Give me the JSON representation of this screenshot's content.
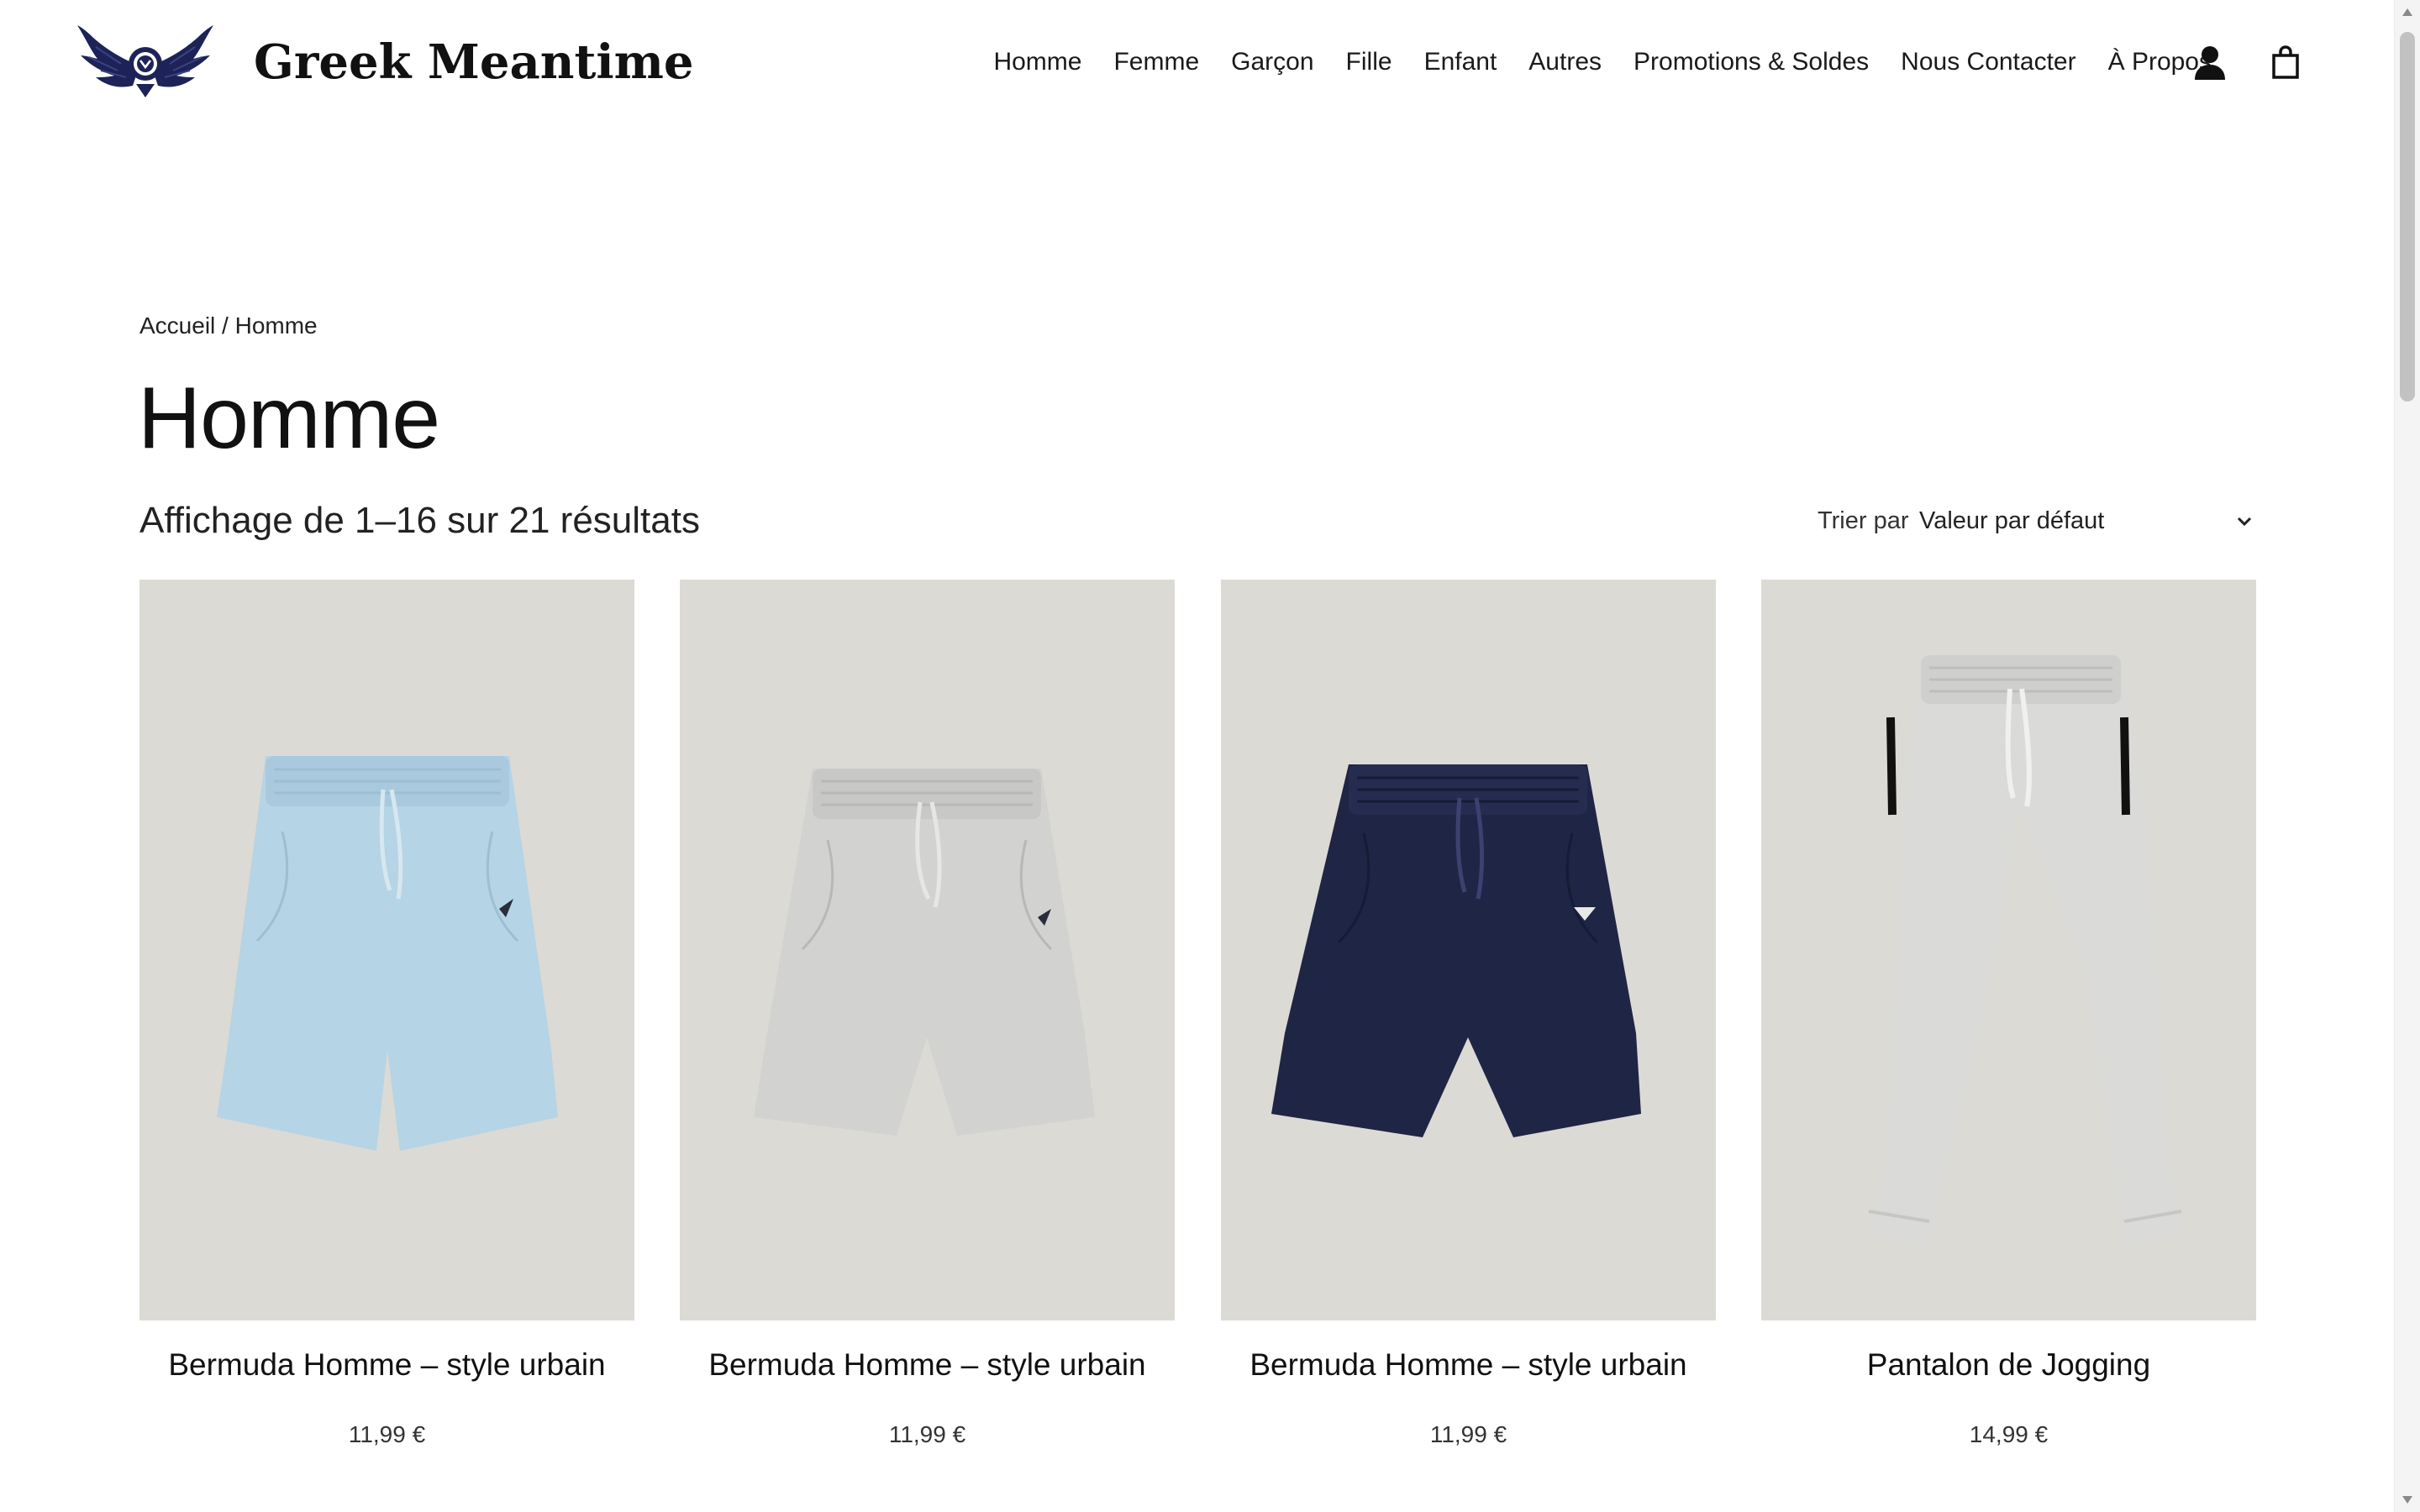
{
  "brand": {
    "name": "Greek Meantime",
    "logo_icon": "winged-crest-icon",
    "accent": "#1d2357"
  },
  "nav": {
    "items": [
      "Homme",
      "Femme",
      "Garçon",
      "Fille",
      "Enfant",
      "Autres",
      "Promotions & Soldes",
      "Nous Contacter",
      "À Propos"
    ],
    "account_icon": "user-icon",
    "cart_icon": "shopping-bag-icon"
  },
  "breadcrumb": {
    "home": "Accueil",
    "separator": " / ",
    "current": "Homme"
  },
  "page": {
    "title": "Homme",
    "results": "Affichage de 1–16 sur 21 résultats"
  },
  "sort": {
    "label": "Trier par",
    "value": "Valeur par défaut"
  },
  "products": [
    {
      "name": "Bermuda Homme – style urbain",
      "price": "11,99 €",
      "color": "#b7d6e6",
      "type": "shorts"
    },
    {
      "name": "Bermuda Homme – style urbain",
      "price": "11,99 €",
      "color": "#d4d4d2",
      "type": "shorts"
    },
    {
      "name": "Bermuda Homme – style urbain",
      "price": "11,99 €",
      "color": "#1f2545",
      "type": "shorts"
    },
    {
      "name": "Pantalon de Jogging",
      "price": "14,99 €",
      "color": "#dcdcda",
      "type": "joggers"
    }
  ]
}
